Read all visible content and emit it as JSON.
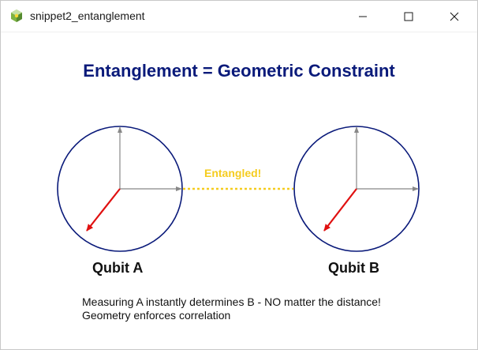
{
  "window": {
    "title": "snippet2_entanglement",
    "app_icon": "python-app-icon",
    "controls": {
      "minimize_icon": "minimize-icon",
      "maximize_icon": "maximize-icon",
      "close_icon": "close-icon"
    }
  },
  "content": {
    "heading": "Entanglement = Geometric Constraint",
    "qubit_a_label": "Qubit A",
    "qubit_b_label": "Qubit B",
    "entangled_label": "Entangled!",
    "note_line1": "Measuring A instantly determines B - NO matter the distance!",
    "note_line2": "Geometry enforces correlation"
  },
  "colors": {
    "heading": "#0a1a7a",
    "circle": "#0a1a7a",
    "axis": "#888888",
    "state_vector": "#e01010",
    "entanglement_link": "#f5cc1f"
  }
}
